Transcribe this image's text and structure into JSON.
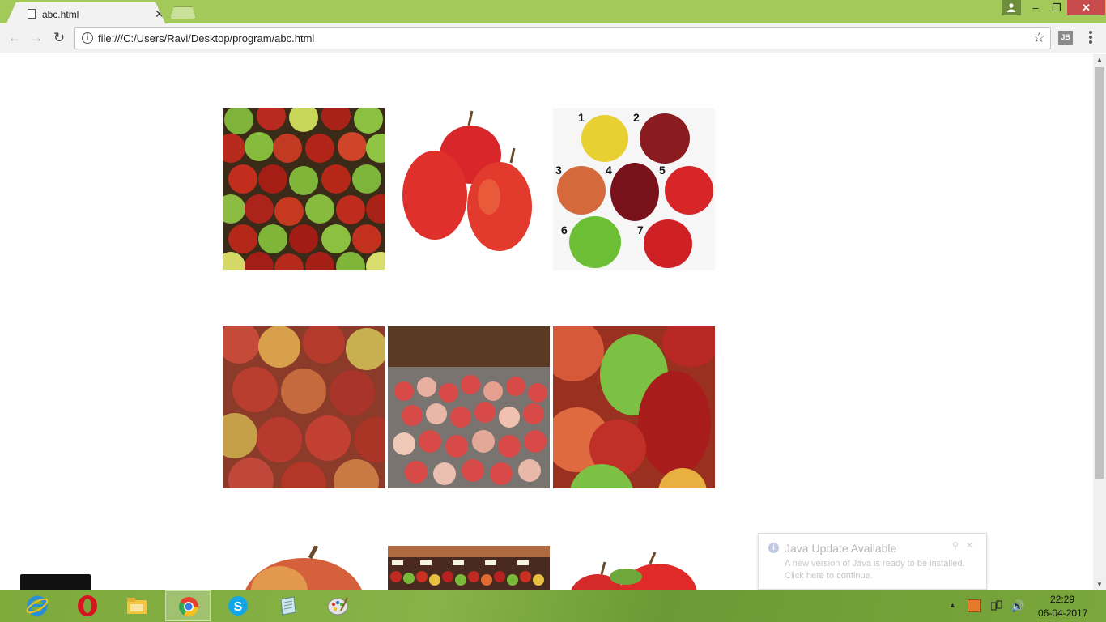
{
  "browser": {
    "tab_title": "abc.html",
    "url": "file:///C:/Users/Ravi/Desktop/program/abc.html",
    "extension_label": "JB"
  },
  "page": {
    "photo_labels": [
      "1",
      "2",
      "3",
      "4",
      "5",
      "6",
      "7"
    ]
  },
  "notification": {
    "title": "Java Update Available",
    "line1": "A new version of Java is ready to be installed.",
    "line2": "Click here to continue."
  },
  "taskbar": {
    "apps": [
      "internet-explorer",
      "opera",
      "file-explorer",
      "chrome",
      "skype",
      "notes-app",
      "paint"
    ],
    "time": "22:29",
    "date": "06-04-2017"
  },
  "colors": {
    "chrome_frame": "#a3c95a",
    "taskbar": "#79a53a",
    "close_button": "#c94c4c"
  }
}
